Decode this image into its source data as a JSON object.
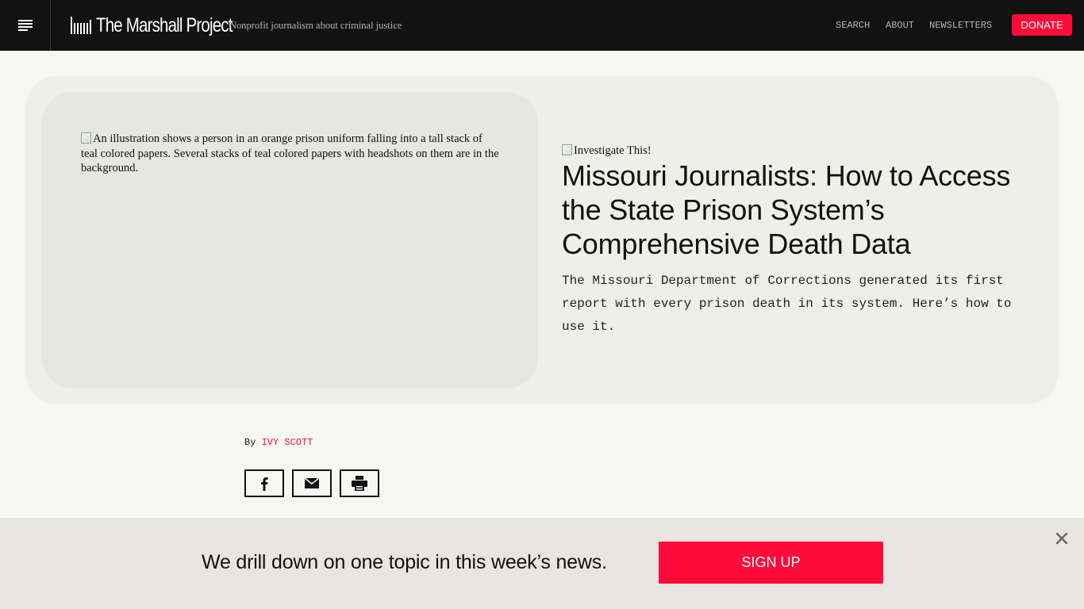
{
  "header": {
    "site_name": "The Marshall Project",
    "tagline": "Nonprofit journalism about criminal justice",
    "nav": [
      "SEARCH",
      "ABOUT",
      "NEWSLETTERS"
    ],
    "donate_label": "DONATE"
  },
  "hero": {
    "image_alt": "An illustration shows a person in an orange prison uniform falling into a tall stack of teal colored papers. Several stacks of teal colored papers with headshots on them are in the background.",
    "kicker_alt": "Investigate This!",
    "headline": "Missouri Journalists: How to Access the State Prison System’s Comprehensive Death Data",
    "dek": "The Missouri Department of Corrections generated its first report with every prison death in its system. Here’s how to use it."
  },
  "byline": {
    "prefix": "By",
    "author": "IVY SCOTT"
  },
  "share": {
    "icons": [
      "facebook-icon",
      "email-icon",
      "print-icon"
    ]
  },
  "newsletter_banner": {
    "text": "We drill down on one topic in this week’s news.",
    "button_label": "SIGN UP",
    "close_icon": "close-icon"
  },
  "colors": {
    "header_bg": "#121212",
    "accent": "#ff0b3a",
    "page_bg": "#f6f6f3",
    "hero_bg": "#eeeeeb",
    "banner_bg": "#e8e5e3"
  }
}
